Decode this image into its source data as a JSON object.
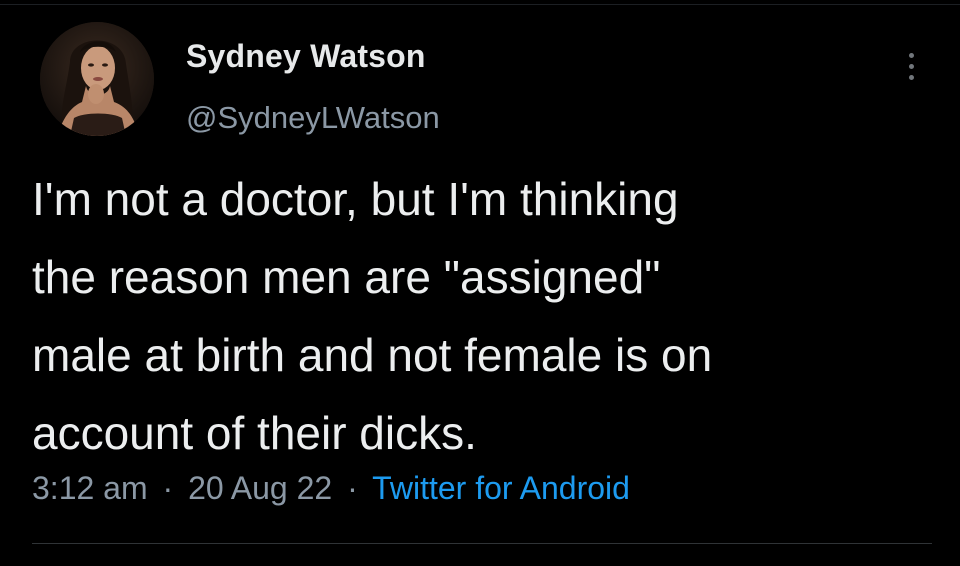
{
  "tweet": {
    "author": {
      "display_name": "Sydney Watson",
      "handle": "@SydneyLWatson",
      "avatar_icon": "profile-photo"
    },
    "more_icon": "more-options-icon",
    "text_lines": [
      "I'm not a doctor, but I'm thinking",
      "the reason men are \"assigned\"",
      "male at birth and not female is on",
      "account of their dicks."
    ],
    "meta": {
      "time": "3:12 am",
      "separator": "·",
      "date": "20 Aug 22",
      "source": "Twitter for Android"
    }
  },
  "colors": {
    "background": "#000000",
    "text": "#e7e9ea",
    "secondary": "#8b98a5",
    "accent": "#1d9bf0"
  }
}
